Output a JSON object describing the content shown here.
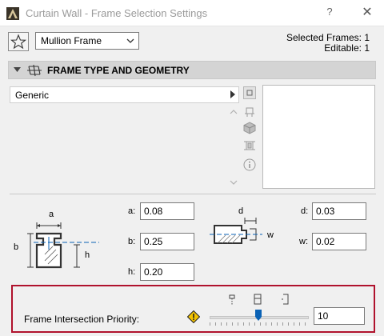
{
  "window": {
    "title": "Curtain Wall - Frame Selection Settings",
    "help_label": "?",
    "close_label": "✕"
  },
  "toolbar": {
    "favorite_icon": "star-icon",
    "frame_class": "Mullion Frame",
    "selected_frames": "Selected Frames: 1",
    "editable": "Editable: 1"
  },
  "section": {
    "title": "FRAME TYPE AND GEOMETRY",
    "frame_type": "Generic"
  },
  "preview_icons": [
    "square-icon",
    "plan-icon",
    "3d-box-icon",
    "section-icon",
    "info-icon"
  ],
  "geometry": {
    "diagram1_labels": {
      "a": "a",
      "b": "b",
      "h": "h"
    },
    "diagram2_labels": {
      "d": "d",
      "w": "w"
    },
    "fields": [
      {
        "label": "a:",
        "value": "0.08"
      },
      {
        "label": "b:",
        "value": "0.25"
      },
      {
        "label": "h:",
        "value": "0.20"
      },
      {
        "label": "d:",
        "value": "0.03"
      },
      {
        "label": "w:",
        "value": "0.02"
      }
    ]
  },
  "priority": {
    "label": "Frame Intersection Priority:",
    "value": "10",
    "slider_level": 0.49
  },
  "colors": {
    "highlight": "#b0122d",
    "accent": "#0a62b5",
    "warning": "#f2c200"
  }
}
